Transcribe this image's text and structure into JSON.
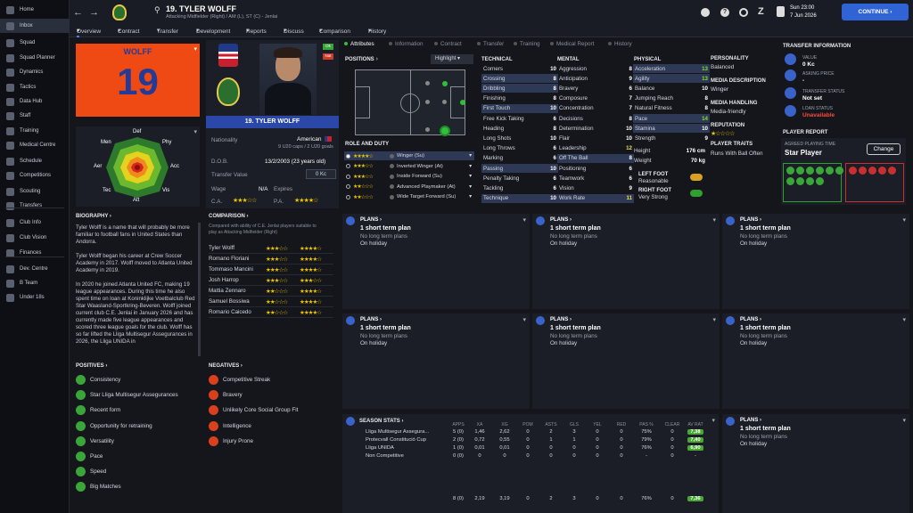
{
  "sidebar": {
    "items": [
      {
        "label": "Home",
        "icon": "home-icon"
      },
      {
        "label": "Inbox",
        "icon": "inbox-icon"
      },
      {
        "label": "Squad",
        "icon": "squad-icon"
      },
      {
        "label": "Squad Planner",
        "icon": "planner-icon"
      },
      {
        "label": "Dynamics",
        "icon": "dynamics-icon"
      },
      {
        "label": "Tactics",
        "icon": "tactics-icon"
      },
      {
        "label": "Data Hub",
        "icon": "data-hub-icon"
      },
      {
        "label": "Staff",
        "icon": "staff-icon"
      },
      {
        "label": "Training",
        "icon": "training-icon"
      },
      {
        "label": "Medical Centre",
        "icon": "medical-icon"
      },
      {
        "label": "Schedule",
        "icon": "schedule-icon"
      },
      {
        "label": "Competitions",
        "icon": "trophy-icon"
      },
      {
        "label": "Scouting",
        "icon": "scouting-icon"
      },
      {
        "label": "Transfers",
        "icon": "transfers-icon"
      },
      {
        "label": "Club Info",
        "icon": "club-info-icon"
      },
      {
        "label": "Club Vision",
        "icon": "vision-icon"
      },
      {
        "label": "Finances",
        "icon": "finances-icon"
      },
      {
        "label": "Dev. Centre",
        "icon": "dev-centre-icon"
      },
      {
        "label": "B Team",
        "icon": "b-team-icon"
      },
      {
        "label": "Under 18s",
        "icon": "under18-icon"
      }
    ]
  },
  "header": {
    "title": "19. TYLER WOLFF",
    "subtitle": "Attacking Midfielder (Right) / AM (L), ST (C) - Jenlai",
    "date_day": "Sun 23:00",
    "date": "7 Jun 2026",
    "continue": "CONTINUE"
  },
  "tabs": [
    "Overview",
    "Contract",
    "Transfer",
    "Development",
    "Reports",
    "Discuss",
    "Comparison",
    "History"
  ],
  "subtabs": [
    "Attributes",
    "Information",
    "Contract",
    "Transfer",
    "Training",
    "Medical Report",
    "History"
  ],
  "shirt": {
    "name": "WOLFF",
    "number": "19"
  },
  "player": {
    "card_name": "19. TYLER WOLFF",
    "nat_label": "Nationality",
    "nat_value": "American",
    "caps": "9 U20 caps / 2 U20 goals",
    "dob_label": "D.O.B.",
    "dob_value": "13/2/2003 (23 years old)",
    "tv_label": "Transfer Value",
    "tv_value": "0 Kc",
    "wage_label": "Wage",
    "wage_value": "N/A",
    "expires_label": "Expires",
    "ca_label": "C.A.",
    "pa_label": "P.A."
  },
  "badges": {
    "ok": "Ok",
    "nat": "Nat"
  },
  "radar": {
    "labels": [
      "Def",
      "Phy",
      "Acc",
      "Vis",
      "Att",
      "Tec",
      "Aer",
      "Men"
    ]
  },
  "positions": {
    "title": "POSITIONS",
    "highlight": "Highlight"
  },
  "roles": {
    "title": "ROLE AND DUTY",
    "items": [
      {
        "name": "Winger (Su)",
        "stars": "★★★★☆"
      },
      {
        "name": "Inverted Winger (At)",
        "stars": "★★★☆☆"
      },
      {
        "name": "Inside Forward (Su)",
        "stars": "★★★☆☆"
      },
      {
        "name": "Advanced Playmaker (At)",
        "stars": "★★☆☆☆"
      },
      {
        "name": "Wide Target Forward (Su)",
        "stars": "★★☆☆☆"
      }
    ]
  },
  "technical": {
    "title": "TECHNICAL",
    "items": [
      [
        "Corners",
        "10"
      ],
      [
        "Crossing",
        "8"
      ],
      [
        "Dribbling",
        "8"
      ],
      [
        "Finishing",
        "8"
      ],
      [
        "First Touch",
        "10"
      ],
      [
        "Free Kick Taking",
        "6"
      ],
      [
        "Heading",
        "8"
      ],
      [
        "Long Shots",
        "10"
      ],
      [
        "Long Throws",
        "6"
      ],
      [
        "Marking",
        "6"
      ],
      [
        "Passing",
        "10"
      ],
      [
        "Penalty Taking",
        "6"
      ],
      [
        "Tackling",
        "6"
      ],
      [
        "Technique",
        "10"
      ]
    ]
  },
  "mental": {
    "title": "MENTAL",
    "items": [
      [
        "Aggression",
        "8"
      ],
      [
        "Anticipation",
        "9"
      ],
      [
        "Bravery",
        "6"
      ],
      [
        "Composure",
        "7"
      ],
      [
        "Concentration",
        "7"
      ],
      [
        "Decisions",
        "8"
      ],
      [
        "Determination",
        "10"
      ],
      [
        "Flair",
        "10"
      ],
      [
        "Leadership",
        "12"
      ],
      [
        "Off The Ball",
        "8"
      ],
      [
        "Positioning",
        "6"
      ],
      [
        "Teamwork",
        "6"
      ],
      [
        "Vision",
        "9"
      ],
      [
        "Work Rate",
        "11"
      ]
    ]
  },
  "physical": {
    "title": "PHYSICAL",
    "items": [
      [
        "Acceleration",
        "13"
      ],
      [
        "Agility",
        "13"
      ],
      [
        "Balance",
        "10"
      ],
      [
        "Jumping Reach",
        "8"
      ],
      [
        "Natural Fitness",
        "8"
      ],
      [
        "Pace",
        "14"
      ],
      [
        "Stamina",
        "10"
      ],
      [
        "Strength",
        "9"
      ]
    ],
    "height_label": "Height",
    "height": "176 cm",
    "weight_label": "Weight",
    "weight": "70 kg",
    "left_foot_label": "LEFT FOOT",
    "left_foot": "Reasonable",
    "right_foot_label": "RIGHT FOOT",
    "right_foot": "Very Strong"
  },
  "personality": {
    "title": "PERSONALITY",
    "value": "Balanced",
    "media_desc_title": "MEDIA DESCRIPTION",
    "media_desc": "Winger",
    "media_handling_title": "MEDIA HANDLING",
    "media_handling": "Media-friendly",
    "reputation_title": "REPUTATION",
    "traits_title": "PLAYER TRAITS",
    "traits": "Runs With Ball Often"
  },
  "transfer_info": {
    "title": "TRANSFER INFORMATION",
    "value_label": "VALUE",
    "value": "0 Kc",
    "asking_label": "ASKING PRICE",
    "asking": "-",
    "status_label": "TRANSFER STATUS",
    "status": "Not set",
    "loan_label": "LOAN STATUS",
    "loan": "Unavailable"
  },
  "player_report": {
    "title": "PLAYER REPORT",
    "agreed_label": "AGREED PLAYING TIME",
    "agreed": "Star Player",
    "change": "Change"
  },
  "biography": {
    "title": "BIOGRAPHY",
    "paragraphs": [
      "Tyler Wolff is a name that will probably be more familiar to football fans in United States than Andorra.",
      "Tyler Wolff began his career at Crew Soccer Academy in 2017. Wolff moved to Atlanta United Academy in 2019.",
      "In 2020 he joined Atlanta United FC, making 19 league appearances. During this time he also spent time on loan at Koninklijke Voetbalclub Red Star Waasland-Sportkring-Beveren. Wolff joined current club C.E. Jenlai in January 2026 and has currently made five league appearances and scored three league goals for the club. Wolff has so far lifted the Lliga Multisegur Assegurances in 2026, the Lliga UNIDA in"
    ]
  },
  "comparison": {
    "title": "COMPARISON",
    "note": "Compared with ability of C.E. Jenlai players suitable to play as Attacking Midfielder (Right)",
    "players": [
      {
        "name": "Tyler Wolff",
        "ca": "★★★☆☆",
        "pa": "★★★★☆"
      },
      {
        "name": "Romano Floriani",
        "ca": "★★★☆☆",
        "pa": "★★★★☆"
      },
      {
        "name": "Tommaso Mancini",
        "ca": "★★★☆☆",
        "pa": "★★★★☆"
      },
      {
        "name": "Josh Harrop",
        "ca": "★★★☆☆",
        "pa": "★★★☆☆"
      },
      {
        "name": "Mattia Zennaro",
        "ca": "★★☆☆☆",
        "pa": "★★★★☆"
      },
      {
        "name": "Samuel Bossiwa",
        "ca": "★★☆☆☆",
        "pa": "★★★★☆"
      },
      {
        "name": "Romario Caicedo",
        "ca": "★★☆☆☆",
        "pa": "★★★★☆"
      }
    ]
  },
  "positives": {
    "title": "POSITIVES",
    "items": [
      "Consistency",
      "Star Lliga Multisegur Assegurances",
      "Recent form",
      "Opportunity for retraining",
      "Versatility",
      "Pace",
      "Speed",
      "Big Matches"
    ]
  },
  "negatives": {
    "title": "NEGATIVES",
    "items": [
      "Competitive Streak",
      "Bravery",
      "Unlikely Core Social Group Fit",
      "Intelligence",
      "Injury Prone"
    ]
  },
  "plans": {
    "title": "PLANS",
    "p1": "1 short term plan",
    "p2": "No long term plans",
    "p3": "On holiday"
  },
  "season_stats": {
    "title": "SEASON STATS",
    "headers": [
      "APPS",
      "XA",
      "XG",
      "POM",
      "ASTS",
      "GLS",
      "YEL",
      "RED",
      "PAS %",
      "CLEAR",
      "AV RAT"
    ],
    "rows": [
      [
        "Lliga Multisegur Assegura...",
        "5 (0)",
        "1,46",
        "2,62",
        "0",
        "2",
        "3",
        "0",
        "0",
        "75%",
        "0",
        "7,38"
      ],
      [
        "Protecvall Constitució Cup",
        "2 (0)",
        "0,72",
        "0,55",
        "0",
        "1",
        "1",
        "0",
        "0",
        "79%",
        "0",
        "7,40"
      ],
      [
        "Lliga UNIDA",
        "1 (0)",
        "0,01",
        "0,01",
        "0",
        "0",
        "0",
        "0",
        "0",
        "76%",
        "0",
        "6,90"
      ],
      [
        "Non Competitive",
        "0 (0)",
        "0",
        "0",
        "0",
        "0",
        "0",
        "0",
        "0",
        "-",
        "0",
        "-"
      ]
    ],
    "total": [
      "8 (0)",
      "2,19",
      "3,19",
      "0",
      "2",
      "3",
      "0",
      "0",
      "76%",
      "0",
      "7,36"
    ]
  },
  "colors": {
    "accent": "#2f63d6",
    "shirt": "#ef4a14",
    "green": "#49a833"
  }
}
